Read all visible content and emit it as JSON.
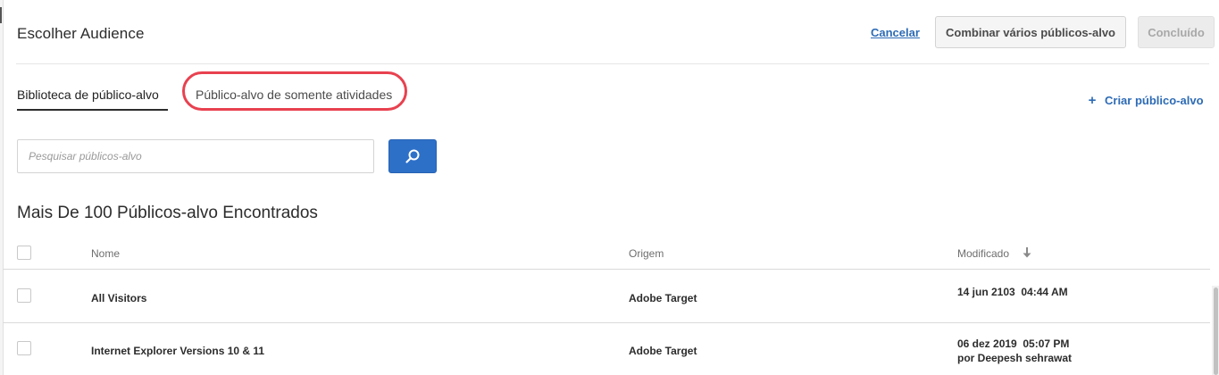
{
  "header": {
    "title": "Escolher Audience",
    "cancel_label": "Cancelar",
    "combine_label": "Combinar vários públicos-alvo",
    "done_label": "Concluído"
  },
  "tabs": [
    {
      "label": "Biblioteca de público-alvo",
      "active": true
    },
    {
      "label": "Público-alvo de somente atividades",
      "active": false,
      "highlighted": true
    }
  ],
  "create_audience": {
    "icon": "plus-icon",
    "label": "Criar público-alvo"
  },
  "search": {
    "placeholder": "Pesquisar públicos-alvo",
    "value": "",
    "button_icon": "search-icon"
  },
  "results_heading": "Mais De 100 Públicos-alvo Encontrados",
  "table": {
    "columns": {
      "name": "Nome",
      "origin": "Origem",
      "modified": "Modificado"
    },
    "sort_icon": "arrow-down-icon",
    "rows": [
      {
        "name": "All Visitors",
        "origin": "Adobe Target",
        "modified_date": "14 jun 2103  04:44 AM",
        "modified_by": ""
      },
      {
        "name": "Internet Explorer Versions 10 & 11",
        "origin": "Adobe Target",
        "modified_date": "06 dez 2019  05:07 PM",
        "modified_by": "por Deepesh sehrawat"
      }
    ]
  },
  "colors": {
    "link": "#2d6bb5",
    "primary_button": "#2d70c8",
    "highlight": "#e8414f"
  }
}
